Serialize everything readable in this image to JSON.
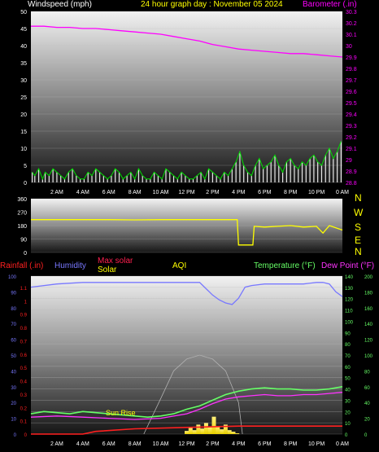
{
  "colors": {
    "wind": "#e8e8e8",
    "gust": "#00dd00",
    "barometer": "#ff00ff",
    "direction": "#ffff00",
    "rainfall": "#ff2020",
    "humidity": "#7878ff",
    "solar": "#ffff00",
    "max_solar": "#ff1f4f",
    "temperature": "#66ff66",
    "dew_point": "#ff33ff",
    "tick_text": "#ffffff",
    "background": "#000000"
  },
  "header": {
    "wind_label": "Windspeed (mph)",
    "title": "24 hour graph day : November 05 2024",
    "baro_label": "Barometer (.in)"
  },
  "direction_panel": {
    "compass": [
      "N",
      "W",
      "S",
      "E",
      "N"
    ]
  },
  "bottom_header": {
    "rainfall": "Rainfall (.in)",
    "humidity": "Humidity",
    "max_solar": "Max solar",
    "solar": "Solar",
    "aqi": "AQI",
    "temperature": "Temperature (°F)",
    "dew_point": "Dew Point (°F)"
  },
  "annotation": {
    "sunrise": "Sun Rise"
  },
  "chart_data": [
    {
      "type": "line",
      "title": "24 hour graph day : November 05 2024",
      "x_ticks": [
        "2 AM",
        "4 AM",
        "6 AM",
        "8 AM",
        "10 AM",
        "12 PM",
        "2 PM",
        "4 PM",
        "6 PM",
        "8 PM",
        "10 PM",
        "0 AM"
      ],
      "y_left": {
        "label": "Windspeed (mph)",
        "ticks": [
          "0",
          "5",
          "10",
          "15",
          "20",
          "25",
          "30",
          "35",
          "40",
          "45",
          "50"
        ],
        "range": [
          0,
          50
        ]
      },
      "y_right": {
        "label": "Barometer (.in)",
        "ticks": [
          "28.8",
          "28.9",
          "29",
          "29.1",
          "29.2",
          "29.3",
          "29.4",
          "29.5",
          "29.6",
          "29.7",
          "29.8",
          "29.9",
          "30",
          "30.1",
          "30.2",
          "30.3"
        ],
        "range": [
          28.8,
          30.3
        ]
      },
      "series": [
        {
          "name": "Barometer (.in)",
          "x_hours": [
            0,
            1,
            2,
            3,
            4,
            5,
            6,
            7,
            8,
            9,
            10,
            11,
            12,
            13,
            14,
            15,
            16,
            17,
            18,
            19,
            20,
            21,
            22,
            23,
            24
          ],
          "values": [
            30.17,
            30.17,
            30.16,
            30.16,
            30.15,
            30.15,
            30.14,
            30.13,
            30.12,
            30.11,
            30.1,
            30.08,
            30.06,
            30.04,
            30.01,
            29.99,
            29.97,
            29.96,
            29.95,
            29.94,
            29.93,
            29.93,
            29.92,
            29.91,
            29.9
          ]
        }
      ],
      "wind_hours": [
        0.1,
        0.3,
        0.6,
        0.9,
        1.1,
        1.4,
        1.7,
        2.0,
        2.3,
        2.6,
        2.9,
        3.2,
        3.5,
        3.8,
        4.1,
        4.4,
        4.7,
        5.0,
        5.3,
        5.6,
        5.9,
        6.2,
        6.5,
        6.8,
        7.1,
        7.4,
        7.7,
        8.0,
        8.3,
        8.6,
        8.9,
        9.2,
        9.5,
        9.8,
        10.1,
        10.4,
        10.7,
        11.0,
        11.3,
        11.6,
        11.9,
        12.2,
        12.5,
        12.8,
        13.1,
        13.4,
        13.7,
        14.0,
        14.3,
        14.6,
        14.9,
        15.2,
        15.5,
        15.8,
        16.1,
        16.4,
        16.7,
        17.0,
        17.3,
        17.6,
        17.9,
        18.2,
        18.5,
        18.8,
        19.1,
        19.4,
        19.7,
        20.0,
        20.3,
        20.6,
        20.9,
        21.2,
        21.5,
        21.8,
        22.1,
        22.4,
        22.7,
        23.0,
        23.3,
        23.6,
        23.9
      ],
      "wind_speed": [
        2,
        1,
        3,
        0,
        2,
        1,
        3,
        2,
        1,
        0,
        2,
        3,
        1,
        0,
        0,
        2,
        1,
        3,
        2,
        1,
        0,
        1,
        3,
        2,
        0,
        1,
        2,
        0,
        3,
        1,
        0,
        0,
        2,
        1,
        0,
        3,
        2,
        1,
        0,
        2,
        1,
        0,
        0,
        1,
        2,
        0,
        3,
        2,
        1,
        0,
        2,
        1,
        3,
        4,
        6,
        3,
        2,
        1,
        3,
        5,
        2,
        3,
        4,
        6,
        3,
        2,
        4,
        5,
        3,
        2,
        4,
        3,
        5,
        6,
        4,
        3,
        5,
        7,
        4,
        6,
        8
      ],
      "wind_gust": [
        3,
        2,
        4,
        1,
        3,
        2,
        4,
        3,
        2,
        1,
        3,
        4,
        2,
        1,
        1,
        3,
        2,
        4,
        3,
        2,
        1,
        2,
        4,
        3,
        1,
        2,
        3,
        1,
        4,
        2,
        1,
        1,
        3,
        2,
        1,
        4,
        3,
        2,
        1,
        3,
        2,
        1,
        1,
        2,
        3,
        1,
        4,
        3,
        2,
        1,
        3,
        2,
        4,
        6,
        9,
        5,
        3,
        2,
        5,
        7,
        4,
        5,
        6,
        8,
        5,
        3,
        6,
        7,
        5,
        4,
        6,
        5,
        7,
        8,
        6,
        5,
        8,
        10,
        7,
        9,
        12
      ]
    },
    {
      "type": "line",
      "y_ticks": [
        "0",
        "90",
        "180",
        "270",
        "360"
      ],
      "range": [
        0,
        360
      ],
      "series": [
        {
          "name": "Wind direction",
          "x_hours": [
            0,
            2,
            4,
            6,
            8,
            10,
            12,
            14,
            15.9,
            16,
            17.1,
            17.2,
            18,
            19,
            20,
            21,
            22,
            22.5,
            23,
            24
          ],
          "values": [
            220,
            220,
            220,
            220,
            218,
            220,
            220,
            220,
            220,
            50,
            50,
            175,
            170,
            175,
            180,
            170,
            175,
            130,
            180,
            150
          ]
        }
      ]
    },
    {
      "type": "line",
      "x_ticks": [
        "2 AM",
        "4 AM",
        "6 AM",
        "8 AM",
        "10 AM",
        "12 PM",
        "2 PM",
        "4 PM",
        "6 PM",
        "8 PM",
        "10 PM",
        "0 AM"
      ],
      "y_left_outer": {
        "label": "Humidity",
        "ticks": [
          "0",
          "10",
          "20",
          "30",
          "40",
          "50",
          "60",
          "70",
          "80",
          "90",
          "100"
        ]
      },
      "y_left_inner": {
        "label": "Rainfall (.in)",
        "ticks": [
          "0",
          "0.1",
          "0.2",
          "0.3",
          "0.4",
          "0.5",
          "0.6",
          "0.7",
          "0.8",
          "0.9",
          "1",
          "1.1"
        ]
      },
      "y_right_inner": {
        "label": "Temperature (°F)",
        "ticks": [
          "0",
          "10",
          "20",
          "30",
          "40",
          "50",
          "60",
          "70",
          "80",
          "90",
          "100",
          "110",
          "120",
          "130",
          "140"
        ]
      },
      "y_right_outer": {
        "label": "Solar",
        "ticks": [
          "0",
          "20",
          "40",
          "60",
          "80",
          "100",
          "120",
          "140",
          "160",
          "180",
          "200"
        ]
      },
      "series": [
        {
          "name": "Humidity",
          "x_hours": [
            0,
            2,
            4,
            6,
            8,
            10,
            12,
            13,
            14,
            14.5,
            15,
            15.5,
            16,
            16.5,
            17,
            18,
            19,
            20,
            21,
            22,
            22.5,
            23,
            23.5,
            24
          ],
          "values": [
            93,
            95,
            96,
            96,
            96,
            96,
            96,
            96,
            88,
            85,
            83,
            82,
            86,
            93,
            94,
            95,
            95,
            95,
            95,
            96,
            96,
            95,
            90,
            87
          ]
        },
        {
          "name": "Temperature (°F)",
          "x_hours": [
            0,
            1,
            2,
            3,
            4,
            5,
            6,
            7,
            8,
            9,
            10,
            11,
            12,
            13,
            14,
            15,
            16,
            17,
            18,
            19,
            20,
            21,
            22,
            23,
            24
          ],
          "values": [
            18,
            20,
            19,
            18,
            20,
            19,
            18,
            17,
            16,
            15,
            16,
            18,
            22,
            25,
            30,
            35,
            38,
            40,
            41,
            40,
            40,
            39,
            39,
            40,
            42
          ]
        },
        {
          "name": "Dew Point (°F)",
          "x_hours": [
            0,
            2,
            4,
            6,
            8,
            10,
            12,
            13,
            14,
            15,
            16,
            17,
            18,
            19,
            20,
            21,
            22,
            23,
            24
          ],
          "values": [
            15,
            16,
            15,
            14,
            13,
            14,
            18,
            22,
            27,
            31,
            33,
            34,
            35,
            34,
            34,
            35,
            35,
            36,
            37
          ]
        },
        {
          "name": "Rainfall (.in)",
          "x_hours": [
            0,
            4,
            5,
            8,
            12,
            16,
            20,
            24
          ],
          "values": [
            0,
            0,
            0.02,
            0.04,
            0.05,
            0.06,
            0.06,
            0.06
          ]
        },
        {
          "name": "Solar",
          "x_hours": [
            12.0,
            12.3,
            12.6,
            12.9,
            13.2,
            13.5,
            13.8,
            14.1,
            14.4,
            14.7,
            15.0,
            15.3,
            15.6,
            15.9
          ],
          "values": [
            4,
            8,
            5,
            12,
            7,
            14,
            9,
            22,
            10,
            6,
            12,
            5,
            3,
            1
          ]
        },
        {
          "name": "Max solar",
          "x_hours": [
            8.7,
            10,
            11,
            12,
            13,
            14,
            15,
            16,
            16.3
          ],
          "values": [
            0,
            45,
            80,
            95,
            100,
            95,
            80,
            40,
            0
          ]
        }
      ]
    }
  ]
}
